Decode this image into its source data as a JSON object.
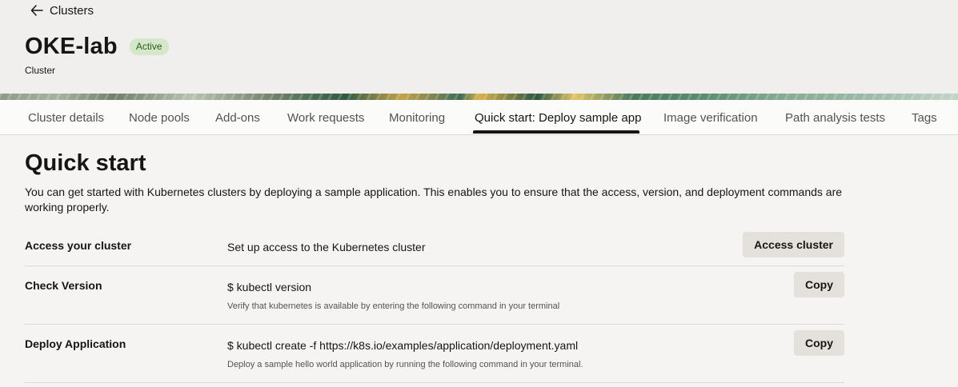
{
  "nav": {
    "back_label": "Clusters"
  },
  "header": {
    "title": "OKE-lab",
    "status": "Active",
    "subtitle": "Cluster"
  },
  "tabs": [
    {
      "label": "Cluster details"
    },
    {
      "label": "Node pools"
    },
    {
      "label": "Add-ons"
    },
    {
      "label": "Work requests"
    },
    {
      "label": "Monitoring"
    },
    {
      "label": "Quick start: Deploy sample app"
    },
    {
      "label": "Image verification"
    },
    {
      "label": "Path analysis tests"
    },
    {
      "label": "Tags"
    }
  ],
  "active_tab": "Quick start: Deploy sample app",
  "quickstart": {
    "title": "Quick start",
    "intro": "You can get started with Kubernetes clusters by deploying a sample application. This enables you to ensure that the access, version, and deployment commands are working properly.",
    "rows": [
      {
        "label": "Access your cluster",
        "text": "Set up access to the Kubernetes cluster",
        "button": "Access cluster"
      },
      {
        "label": "Check Version",
        "command": "$ kubectl version",
        "help": "Verify that kubernetes is available by entering the following command in your terminal",
        "button": "Copy"
      },
      {
        "label": "Deploy Application",
        "command": "$ kubectl create -f https://k8s.io/examples/application/deployment.yaml",
        "help": "Deploy a sample hello world application by running the following command in your terminal.",
        "button": "Copy"
      }
    ]
  },
  "colors": {
    "background": "#f5f4f2",
    "header_background": "#f1efed",
    "status_badge_bg": "#d4e7c8",
    "status_badge_text": "#2f5a1f",
    "button_bg": "#e4e1dd",
    "text": "#161513"
  },
  "icons": {
    "back": "arrow-left-icon"
  }
}
